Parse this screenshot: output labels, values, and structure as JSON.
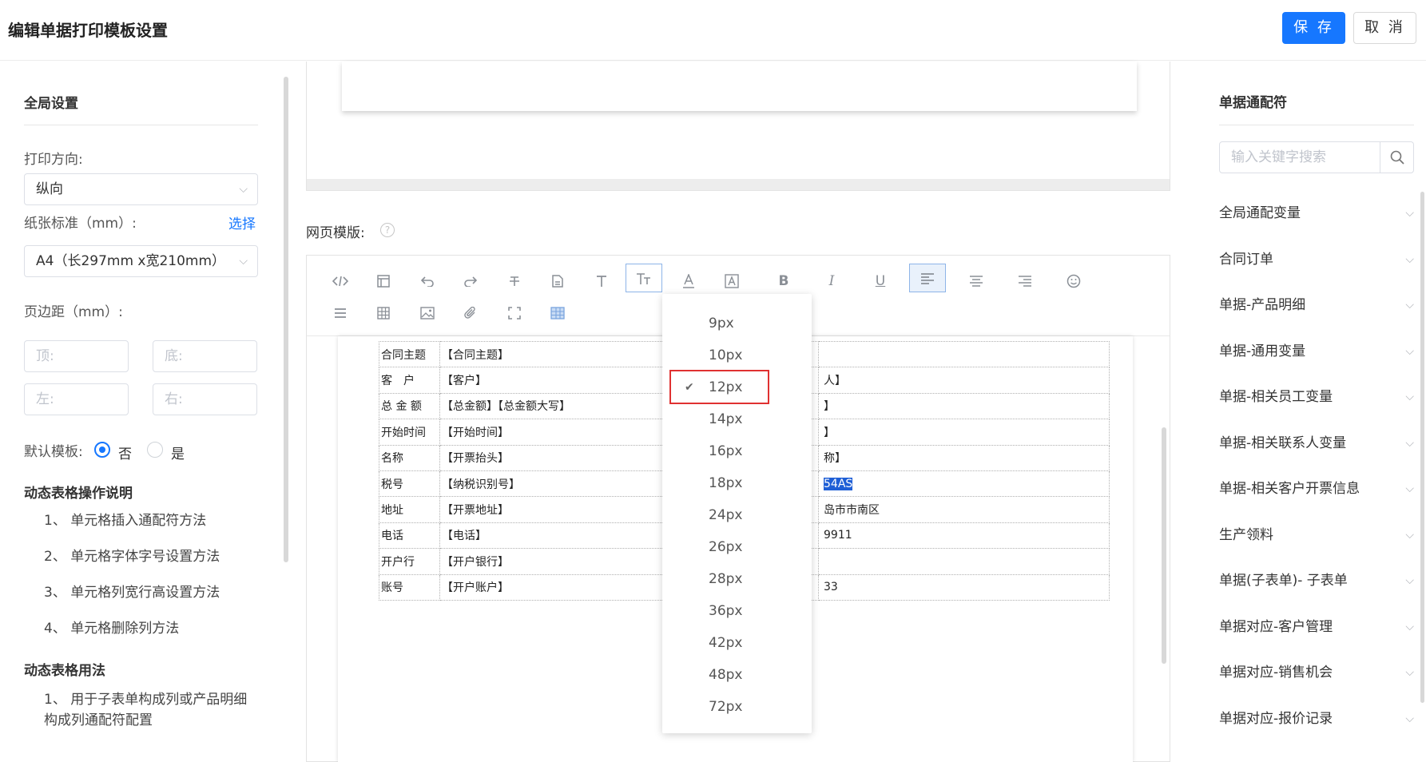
{
  "header": {
    "title": "编辑单据打印模板设置",
    "save": "保 存",
    "cancel": "取 消"
  },
  "left": {
    "global_title": "全局设置",
    "orientation_label": "打印方向:",
    "orientation_value": "纵向",
    "paper_label": "纸张标准（mm）:",
    "paper_choose": "选择",
    "paper_value": "A4（长297mm x宽210mm）",
    "margin_label": "页边距（mm）:",
    "margin_top": "顶:",
    "margin_bottom": "底:",
    "margin_left": "左:",
    "margin_right": "右:",
    "default_label": "默认模板:",
    "default_no": "否",
    "default_yes": "是",
    "ops_title": "动态表格操作说明",
    "ops": [
      "1、 单元格插入通配符方法",
      "2、 单元格字体字号设置方法",
      "3、 单元格列宽行高设置方法",
      "4、 单元格删除列方法"
    ],
    "usage_title": "动态表格用法",
    "usage": [
      "1、 用于子表单构成列或产品明细构成列通配符配置"
    ]
  },
  "middle": {
    "web_template_label": "网页模版:",
    "help": "?",
    "table_rows": [
      {
        "l": "合同主题",
        "v": "【合同主题】",
        "r": ""
      },
      {
        "l": "客　户",
        "v": "【客户】",
        "r": "人】"
      },
      {
        "l": "总 金 额",
        "v": "【总金额】【总金额大写】",
        "r": "】"
      },
      {
        "l": "开始时间",
        "v": "【开始时间】",
        "r": "】"
      },
      {
        "l": "名称",
        "v": "【开票抬头】",
        "r": "称】"
      },
      {
        "l": "税号",
        "v": "【纳税识别号】",
        "r": "54AS"
      },
      {
        "l": "地址",
        "v": "【开票地址】",
        "r": "岛市市南区"
      },
      {
        "l": "电话",
        "v": "【电话】",
        "r": "9911"
      },
      {
        "l": "开户行",
        "v": "【开户银行】",
        "r": ""
      },
      {
        "l": "账号",
        "v": "【开户账户】",
        "r": "33"
      }
    ]
  },
  "font_size_dropdown": {
    "options": [
      "9px",
      "10px",
      "12px",
      "14px",
      "16px",
      "18px",
      "24px",
      "26px",
      "28px",
      "36px",
      "42px",
      "48px",
      "72px"
    ],
    "selected": "12px",
    "check": "✔"
  },
  "right": {
    "title": "单据通配符",
    "search_placeholder": "输入关键字搜索",
    "items": [
      "全局通配变量",
      "合同订单",
      "单据-产品明细",
      "单据-通用变量",
      "单据-相关员工变量",
      "单据-相关联系人变量",
      "单据-相关客户开票信息",
      "生产领料",
      "单据(子表单)- 子表单",
      "单据对应-客户管理",
      "单据对应-销售机会",
      "单据对应-报价记录"
    ]
  },
  "colors": {
    "primary": "#1677ff",
    "highlight": "#e03131"
  }
}
